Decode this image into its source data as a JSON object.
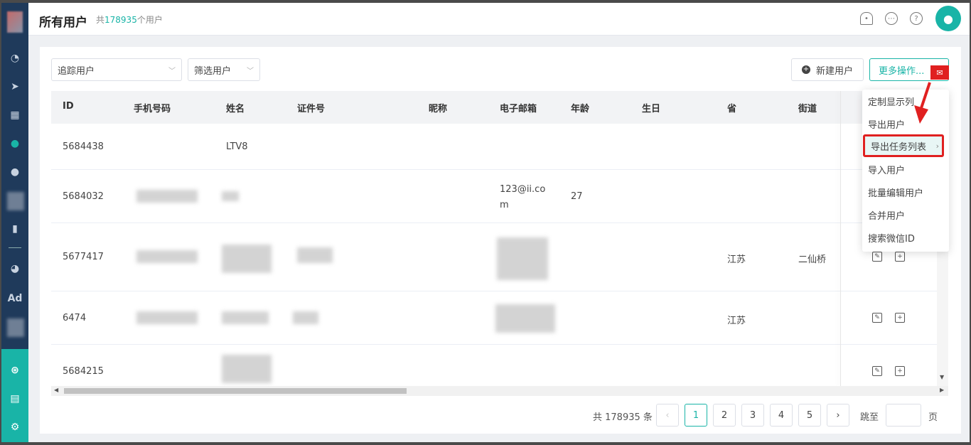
{
  "header": {
    "title": "所有用户",
    "count_prefix": "共",
    "count": "178935",
    "count_suffix": "个用户"
  },
  "toolbar": {
    "track_select": "追踪用户",
    "filter_select": "筛选用户",
    "new_user": "新建用户",
    "more_actions": "更多操作..."
  },
  "table": {
    "columns": [
      "ID",
      "手机号码",
      "姓名",
      "证件号",
      "昵称",
      "电子邮箱",
      "年龄",
      "生日",
      "省",
      "街道"
    ],
    "rows": [
      {
        "id": "5684438",
        "name": "LTV8",
        "email1": "",
        "email2": "",
        "age": "",
        "province": "",
        "street": ""
      },
      {
        "id": "5684032",
        "name": "",
        "email1": "123@ii.co",
        "email2": "m",
        "age": "27",
        "province": "",
        "street": ""
      },
      {
        "id": "5677417",
        "name": "",
        "email1": "",
        "email2": "",
        "age": "",
        "province": "江苏",
        "street": "二仙桥"
      },
      {
        "id": "6474",
        "name": "",
        "email1": "",
        "email2": "",
        "age": "",
        "province": "江苏",
        "street": ""
      },
      {
        "id": "5684215",
        "name": "",
        "email1": "",
        "email2": "",
        "age": "",
        "province": "",
        "street": ""
      }
    ]
  },
  "dropdown": {
    "items": [
      "定制显示列",
      "导出用户",
      "导出任务列表",
      "导入用户",
      "批量编辑用户",
      "合并用户",
      "搜索微信ID"
    ],
    "highlighted": "导出任务列表"
  },
  "pagination": {
    "total_label": "共 178935 条",
    "pages": [
      "1",
      "2",
      "3",
      "4",
      "5"
    ],
    "current": "1",
    "jump_label": "跳至",
    "page_unit": "页"
  },
  "icons": {
    "sidebar": [
      "dashboard-icon",
      "send-icon",
      "layout-icon",
      "user-icon",
      "users-icon",
      "bar-chart-icon",
      "wechat-icon",
      "ad-icon",
      "network-icon",
      "server-icon",
      "gear-icon"
    ],
    "topbar": [
      "bell-icon",
      "chat-icon",
      "help-icon",
      "avatar-icon"
    ]
  },
  "colors": {
    "accent": "#19b4a7",
    "sidebar": "#1f3a5b",
    "highlight_box": "#e02020"
  }
}
